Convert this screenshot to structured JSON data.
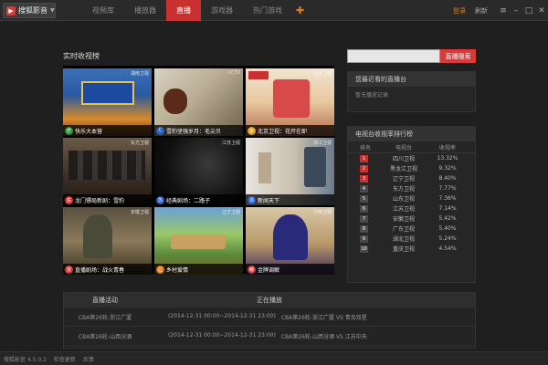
{
  "app": {
    "name": "搜狐影音"
  },
  "tabs": [
    {
      "label": "视频库"
    },
    {
      "label": "播放器"
    },
    {
      "label": "直播"
    },
    {
      "label": "游戏器"
    },
    {
      "label": "热门游戏"
    }
  ],
  "header": {
    "login": "登录",
    "refresh": "刷新"
  },
  "main": {
    "section_title": "实时收视榜"
  },
  "tiles": [
    {
      "caption": "快乐大本营",
      "tag": "湖南卫视"
    },
    {
      "caption": "雪豹坚强岁月：毛尖贝",
      "tag": "CCTV"
    },
    {
      "caption": "北京卫视：花开在即",
      "tag": "北京卫视"
    },
    {
      "caption": "龙门镖局新剧：雪豹",
      "tag": "东方卫视"
    },
    {
      "caption": "经典剧场：二路子",
      "tag": "江苏卫视"
    },
    {
      "caption": "新闻天下",
      "tag": "浙江卫视"
    },
    {
      "caption": "直播剧场：战火青春",
      "tag": "安徽卫视"
    },
    {
      "caption": "乡村爱情",
      "tag": "辽宁卫视"
    },
    {
      "caption": "金牌调解",
      "tag": "江西卫视"
    }
  ],
  "search": {
    "placeholder": "",
    "button": "直播搜索"
  },
  "recent": {
    "title": "您最近看的直播台",
    "empty": "暂无播放记录"
  },
  "ranking": {
    "title": "电视台收视率排行榜",
    "col_rank": "排名",
    "col_channel": "电视台",
    "col_rate": "收视率",
    "rows": [
      {
        "rank": "1",
        "name": "四川卫视",
        "rate": "13.32%"
      },
      {
        "rank": "2",
        "name": "黑龙江卫视",
        "rate": "9.32%"
      },
      {
        "rank": "3",
        "name": "辽宁卫视",
        "rate": "8.40%"
      },
      {
        "rank": "4",
        "name": "东方卫视",
        "rate": "7.77%"
      },
      {
        "rank": "5",
        "name": "山东卫视",
        "rate": "7.36%"
      },
      {
        "rank": "6",
        "name": "江苏卫视",
        "rate": "7.14%"
      },
      {
        "rank": "7",
        "name": "安徽卫视",
        "rate": "5.42%"
      },
      {
        "rank": "8",
        "name": "广东卫视",
        "rate": "5.40%"
      },
      {
        "rank": "9",
        "name": "湖北卫视",
        "rate": "5.24%"
      },
      {
        "rank": "10",
        "name": "重庆卫视",
        "rate": "4.54%"
      }
    ]
  },
  "schedule": {
    "col_event": "直播活动",
    "col_playing": "正在播放",
    "rows": [
      {
        "event": "CBA第26轮-浙江广厦",
        "time": "(2014-12-31 00:00~2014-12-31 23:00)",
        "match": "CBA第26轮-浙江广厦 VS 青岛双星"
      },
      {
        "event": "CBA第26轮-山西汾酒",
        "time": "(2014-12-31 00:00~2014-12-31 23:00)",
        "match": "CBA第26轮-山西汾酒 VS 江苏中天"
      }
    ]
  },
  "status": {
    "version": "搜狐影音 4.5.0.2",
    "check_update": "检查更新",
    "feedback": "反馈"
  },
  "colors": {
    "accent": "#c93131",
    "orange": "#e07b1f",
    "background": "#1f1f1f"
  }
}
